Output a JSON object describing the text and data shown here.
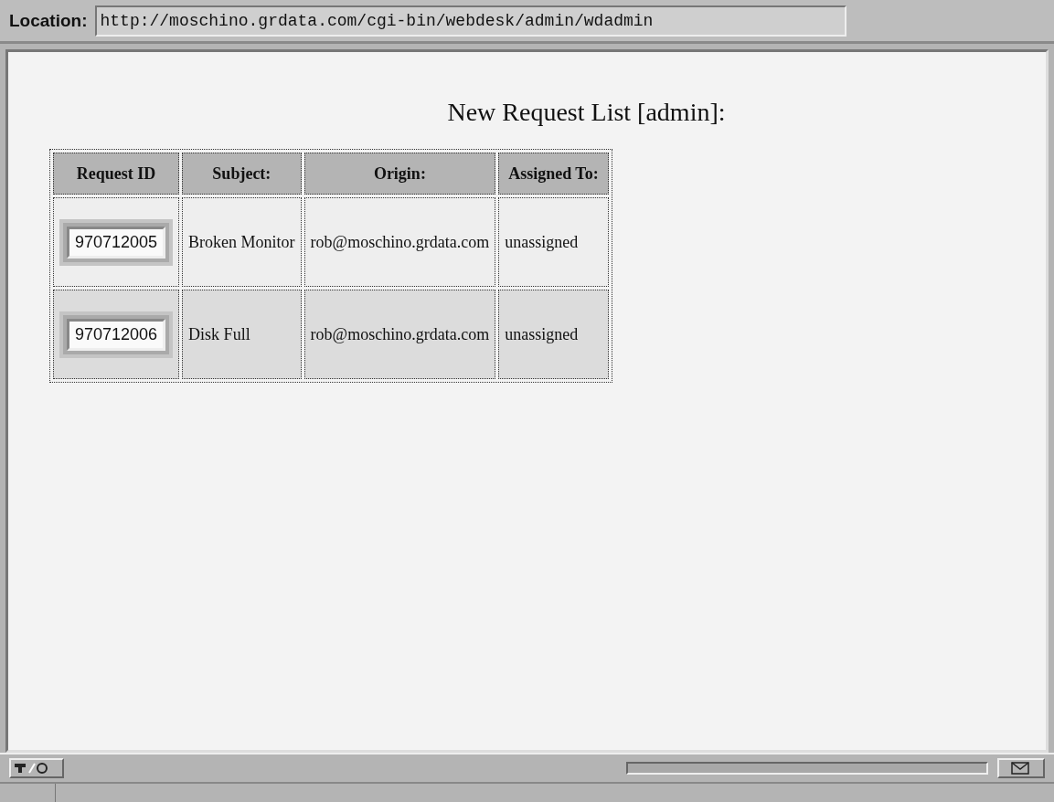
{
  "location_bar": {
    "label": "Location:",
    "url": "http://moschino.grdata.com/cgi-bin/webdesk/admin/wdadmin"
  },
  "page": {
    "title": "New Request List [admin]:",
    "table": {
      "columns": [
        "Request ID",
        "Subject:",
        "Origin:",
        "Assigned To:"
      ],
      "rows": [
        {
          "request_id": "970712005",
          "subject": "Broken Monitor",
          "origin": "rob@moschino.grdata.com",
          "assigned_to": "unassigned"
        },
        {
          "request_id": "970712006",
          "subject": "Disk Full",
          "origin": "rob@moschino.grdata.com",
          "assigned_to": "unassigned"
        }
      ]
    }
  }
}
